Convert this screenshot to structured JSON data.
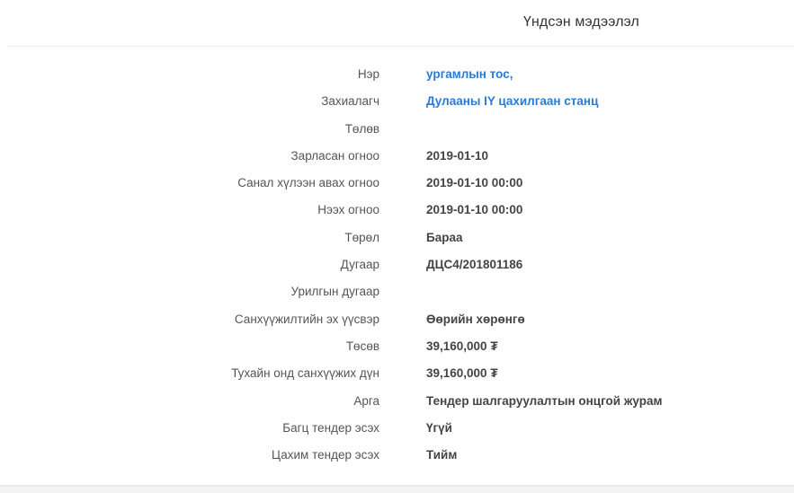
{
  "header": {
    "title": "Үндсэн мэдээлэл"
  },
  "colors": {
    "link": "#2a7ad6",
    "label": "#555555",
    "value": "#444444"
  },
  "fields": [
    {
      "label": "Нэр",
      "value": "ургамлын тос,",
      "link": true
    },
    {
      "label": "Захиалагч",
      "value": "Дулааны IY цахилгаан станц",
      "link": true
    },
    {
      "label": "Төлөв",
      "value": ""
    },
    {
      "label": "Зарласан огноо",
      "value": "2019-01-10"
    },
    {
      "label": "Санал хүлээн авах огноо",
      "value": "2019-01-10 00:00"
    },
    {
      "label": "Нээх огноо",
      "value": "2019-01-10 00:00"
    },
    {
      "label": "Төрөл",
      "value": "Бараа"
    },
    {
      "label": "Дугаар",
      "value": "ДЦС4/201801186"
    },
    {
      "label": "Урилгын дугаар",
      "value": ""
    },
    {
      "label": "Санхүүжилтийн эх үүсвэр",
      "value": "Өөрийн хөрөнгө"
    },
    {
      "label": "Төсөв",
      "value": "39,160,000 ₮"
    },
    {
      "label": "Тухайн онд санхүүжих дүн",
      "value": "39,160,000 ₮"
    },
    {
      "label": "Арга",
      "value": "Тендер шалгаруулалтын онцгой журам"
    },
    {
      "label": "Багц тендер эсэх",
      "value": "Үгүй"
    },
    {
      "label": "Цахим тендер эсэх",
      "value": "Тийм"
    }
  ]
}
